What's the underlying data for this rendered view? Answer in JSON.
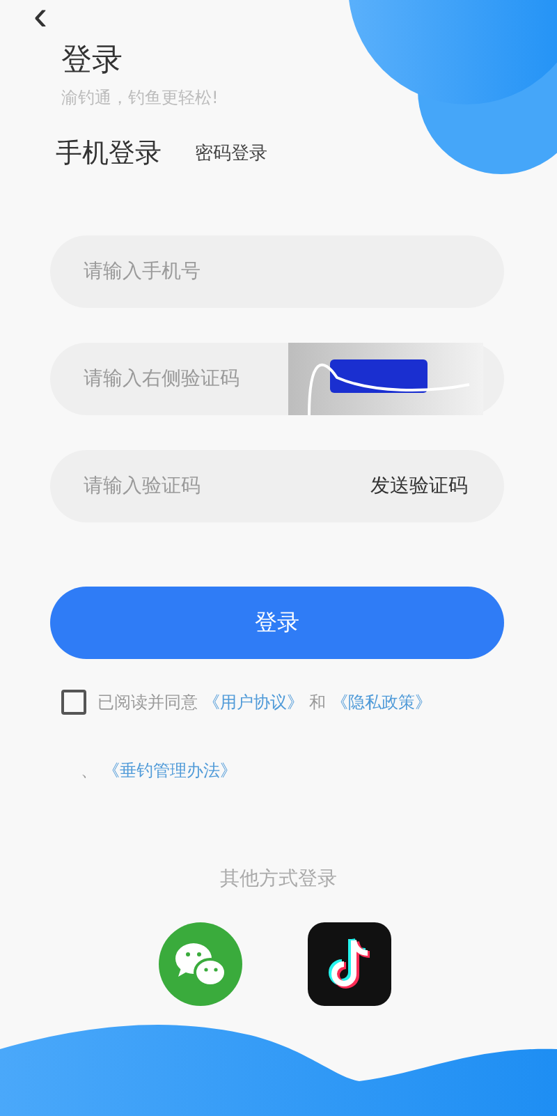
{
  "back": {
    "glyph": "‹"
  },
  "title": "登录",
  "subtitle": "渝钓通，钓鱼更轻松!",
  "tabs": [
    {
      "label": "手机登录",
      "selected": true
    },
    {
      "label": "密码登录",
      "selected": false
    }
  ],
  "fields": [
    {
      "kind": "plain",
      "placeholder": "请输入手机号"
    },
    {
      "kind": "captcha",
      "placeholder": "请输入右侧验证码"
    },
    {
      "kind": "sms",
      "placeholder": "请输入验证码",
      "action": "发送验证码"
    }
  ],
  "login_button": "登录",
  "agreement": {
    "checked": false,
    "lines": [
      [
        {
          "kind": "text",
          "text": "已阅读并同意"
        },
        {
          "kind": "link",
          "text": "《用户协议》"
        },
        {
          "kind": "text",
          "text": "和"
        },
        {
          "kind": "link",
          "text": "《隐私政策》"
        }
      ],
      [
        {
          "kind": "text",
          "text": "、"
        },
        {
          "kind": "link",
          "text": "《垂钓管理办法》"
        }
      ]
    ]
  },
  "other_login": {
    "label": "其他方式登录",
    "options": [
      {
        "kind": "wechat"
      },
      {
        "kind": "douyin"
      }
    ]
  }
}
